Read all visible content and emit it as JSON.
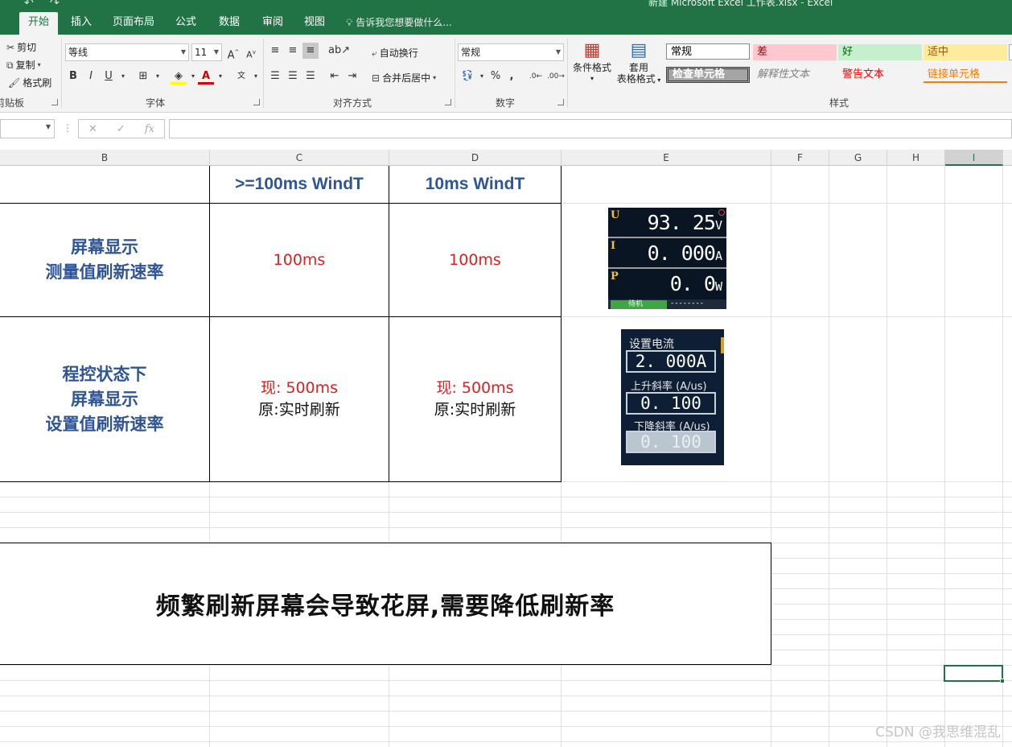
{
  "window": {
    "title": "新建 Microsoft Excel 工作表.xlsx - Excel"
  },
  "tabs": [
    "开始",
    "插入",
    "页面布局",
    "公式",
    "数据",
    "审阅",
    "视图"
  ],
  "tell_me": "告诉我您想要做什么...",
  "ribbon": {
    "clipboard": {
      "cut": "剪切",
      "copy": "复制",
      "format_painter": "格式刷",
      "label": "剪贴板"
    },
    "font": {
      "name": "等线",
      "size": "11",
      "label": "字体",
      "bold": "B",
      "italic": "I",
      "underline": "U"
    },
    "alignment": {
      "wrap": "自动换行",
      "merge": "合并后居中",
      "label": "对齐方式"
    },
    "number": {
      "format": "常规",
      "percent": "%",
      "comma": ",",
      "label": "数字"
    },
    "styles_buttons": {
      "conditional": "条件格式",
      "table_line1": "套用",
      "table_line2": "表格格式"
    },
    "styles": {
      "label": "样式",
      "items": [
        {
          "name": "常规",
          "color": "#000000",
          "bg": "#ffffff"
        },
        {
          "name": "差",
          "color": "#9c0006",
          "bg": "#ffc7ce"
        },
        {
          "name": "好",
          "color": "#006100",
          "bg": "#c6efce"
        },
        {
          "name": "适中",
          "color": "#9c5700",
          "bg": "#ffeb9c"
        },
        {
          "name": "检查单元格",
          "color": "#ffffff",
          "bg": "#a5a5a5"
        },
        {
          "name": "解释性文本",
          "color": "#7f7f7f",
          "bg": "#f3f3f3"
        },
        {
          "name": "警告文本",
          "color": "#ff0000",
          "bg": "#f3f3f3"
        },
        {
          "name": "链接单元格",
          "color": "#fa7d00",
          "bg": "#f3f3f3"
        }
      ]
    }
  },
  "formula_bar": {
    "fx": "fx",
    "value": ""
  },
  "columns": [
    "B",
    "C",
    "D",
    "E",
    "F",
    "G",
    "H",
    "I"
  ],
  "sheet": {
    "header_c": ">=100ms WindT",
    "header_d": "10ms WindT",
    "row1_label_line1": "屏幕显示",
    "row1_label_line2": "测量值刷新速率",
    "row1_c": "100ms",
    "row1_d": "100ms",
    "row2_label_line1": "程控状态下",
    "row2_label_line2": "屏幕显示",
    "row2_label_line3": "设置值刷新速率",
    "row2_c_line1": "现: 500ms",
    "row2_c_line2": "原:实时刷新",
    "row2_d_line1": "现: 500ms",
    "row2_d_line2": "原:实时刷新",
    "banner": "频繁刷新屏幕会导致花屏,需要降低刷新率"
  },
  "display1": {
    "u_label": "U",
    "u_value": "93. 25",
    "u_unit": "V",
    "i_label": "I",
    "i_value": "0. 000",
    "i_unit": "A",
    "p_label": "P",
    "p_value": "0. 0",
    "p_unit": "W",
    "status": "待机",
    "status_dash": "--------"
  },
  "display2": {
    "set_current_label": "设置电流",
    "set_current_value": "2. 000A",
    "rise_label": "上升斜率 (A/us)",
    "rise_value": "0. 100",
    "fall_label": "下降斜率 (A/us)",
    "fall_value": "0. 100"
  },
  "watermark": "CSDN @我思维混乱"
}
